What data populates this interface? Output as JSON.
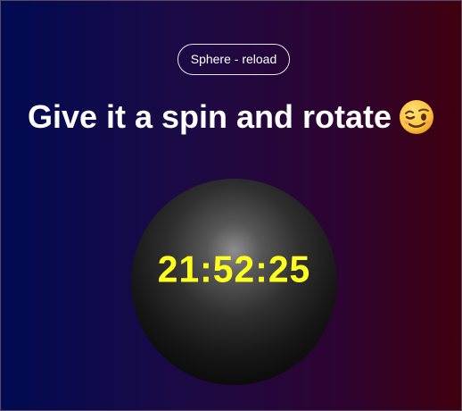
{
  "reload_button": {
    "label": "Sphere - reload"
  },
  "headline": {
    "text": "Give it a spin and rotate",
    "emoji_icon": "winking-face-icon"
  },
  "sphere": {
    "time_text": "21:52:25",
    "text_color": "#ffff1e"
  },
  "colors": {
    "background_left": "#010a52",
    "background_right": "#40000e",
    "text": "#ffffff"
  }
}
